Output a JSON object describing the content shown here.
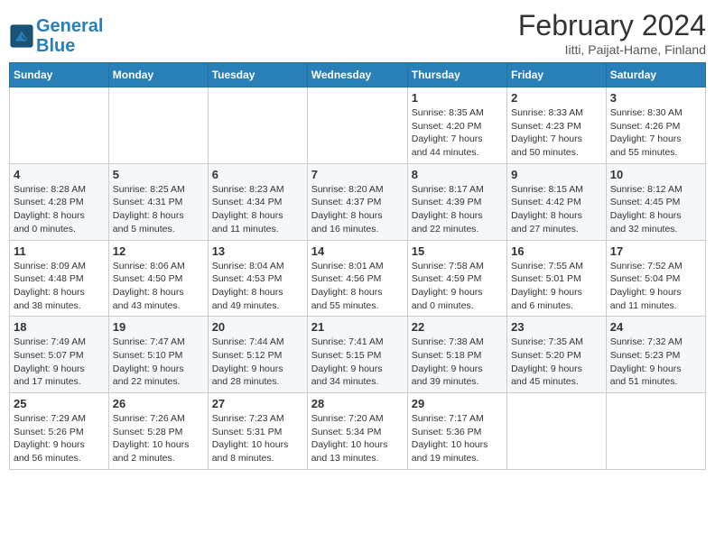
{
  "header": {
    "logo_line1": "General",
    "logo_line2": "Blue",
    "month": "February 2024",
    "location": "Iitti, Paijat-Hame, Finland"
  },
  "weekdays": [
    "Sunday",
    "Monday",
    "Tuesday",
    "Wednesday",
    "Thursday",
    "Friday",
    "Saturday"
  ],
  "weeks": [
    [
      {
        "day": "",
        "info": ""
      },
      {
        "day": "",
        "info": ""
      },
      {
        "day": "",
        "info": ""
      },
      {
        "day": "",
        "info": ""
      },
      {
        "day": "1",
        "info": "Sunrise: 8:35 AM\nSunset: 4:20 PM\nDaylight: 7 hours\nand 44 minutes."
      },
      {
        "day": "2",
        "info": "Sunrise: 8:33 AM\nSunset: 4:23 PM\nDaylight: 7 hours\nand 50 minutes."
      },
      {
        "day": "3",
        "info": "Sunrise: 8:30 AM\nSunset: 4:26 PM\nDaylight: 7 hours\nand 55 minutes."
      }
    ],
    [
      {
        "day": "4",
        "info": "Sunrise: 8:28 AM\nSunset: 4:28 PM\nDaylight: 8 hours\nand 0 minutes."
      },
      {
        "day": "5",
        "info": "Sunrise: 8:25 AM\nSunset: 4:31 PM\nDaylight: 8 hours\nand 5 minutes."
      },
      {
        "day": "6",
        "info": "Sunrise: 8:23 AM\nSunset: 4:34 PM\nDaylight: 8 hours\nand 11 minutes."
      },
      {
        "day": "7",
        "info": "Sunrise: 8:20 AM\nSunset: 4:37 PM\nDaylight: 8 hours\nand 16 minutes."
      },
      {
        "day": "8",
        "info": "Sunrise: 8:17 AM\nSunset: 4:39 PM\nDaylight: 8 hours\nand 22 minutes."
      },
      {
        "day": "9",
        "info": "Sunrise: 8:15 AM\nSunset: 4:42 PM\nDaylight: 8 hours\nand 27 minutes."
      },
      {
        "day": "10",
        "info": "Sunrise: 8:12 AM\nSunset: 4:45 PM\nDaylight: 8 hours\nand 32 minutes."
      }
    ],
    [
      {
        "day": "11",
        "info": "Sunrise: 8:09 AM\nSunset: 4:48 PM\nDaylight: 8 hours\nand 38 minutes."
      },
      {
        "day": "12",
        "info": "Sunrise: 8:06 AM\nSunset: 4:50 PM\nDaylight: 8 hours\nand 43 minutes."
      },
      {
        "day": "13",
        "info": "Sunrise: 8:04 AM\nSunset: 4:53 PM\nDaylight: 8 hours\nand 49 minutes."
      },
      {
        "day": "14",
        "info": "Sunrise: 8:01 AM\nSunset: 4:56 PM\nDaylight: 8 hours\nand 55 minutes."
      },
      {
        "day": "15",
        "info": "Sunrise: 7:58 AM\nSunset: 4:59 PM\nDaylight: 9 hours\nand 0 minutes."
      },
      {
        "day": "16",
        "info": "Sunrise: 7:55 AM\nSunset: 5:01 PM\nDaylight: 9 hours\nand 6 minutes."
      },
      {
        "day": "17",
        "info": "Sunrise: 7:52 AM\nSunset: 5:04 PM\nDaylight: 9 hours\nand 11 minutes."
      }
    ],
    [
      {
        "day": "18",
        "info": "Sunrise: 7:49 AM\nSunset: 5:07 PM\nDaylight: 9 hours\nand 17 minutes."
      },
      {
        "day": "19",
        "info": "Sunrise: 7:47 AM\nSunset: 5:10 PM\nDaylight: 9 hours\nand 22 minutes."
      },
      {
        "day": "20",
        "info": "Sunrise: 7:44 AM\nSunset: 5:12 PM\nDaylight: 9 hours\nand 28 minutes."
      },
      {
        "day": "21",
        "info": "Sunrise: 7:41 AM\nSunset: 5:15 PM\nDaylight: 9 hours\nand 34 minutes."
      },
      {
        "day": "22",
        "info": "Sunrise: 7:38 AM\nSunset: 5:18 PM\nDaylight: 9 hours\nand 39 minutes."
      },
      {
        "day": "23",
        "info": "Sunrise: 7:35 AM\nSunset: 5:20 PM\nDaylight: 9 hours\nand 45 minutes."
      },
      {
        "day": "24",
        "info": "Sunrise: 7:32 AM\nSunset: 5:23 PM\nDaylight: 9 hours\nand 51 minutes."
      }
    ],
    [
      {
        "day": "25",
        "info": "Sunrise: 7:29 AM\nSunset: 5:26 PM\nDaylight: 9 hours\nand 56 minutes."
      },
      {
        "day": "26",
        "info": "Sunrise: 7:26 AM\nSunset: 5:28 PM\nDaylight: 10 hours\nand 2 minutes."
      },
      {
        "day": "27",
        "info": "Sunrise: 7:23 AM\nSunset: 5:31 PM\nDaylight: 10 hours\nand 8 minutes."
      },
      {
        "day": "28",
        "info": "Sunrise: 7:20 AM\nSunset: 5:34 PM\nDaylight: 10 hours\nand 13 minutes."
      },
      {
        "day": "29",
        "info": "Sunrise: 7:17 AM\nSunset: 5:36 PM\nDaylight: 10 hours\nand 19 minutes."
      },
      {
        "day": "",
        "info": ""
      },
      {
        "day": "",
        "info": ""
      }
    ]
  ]
}
